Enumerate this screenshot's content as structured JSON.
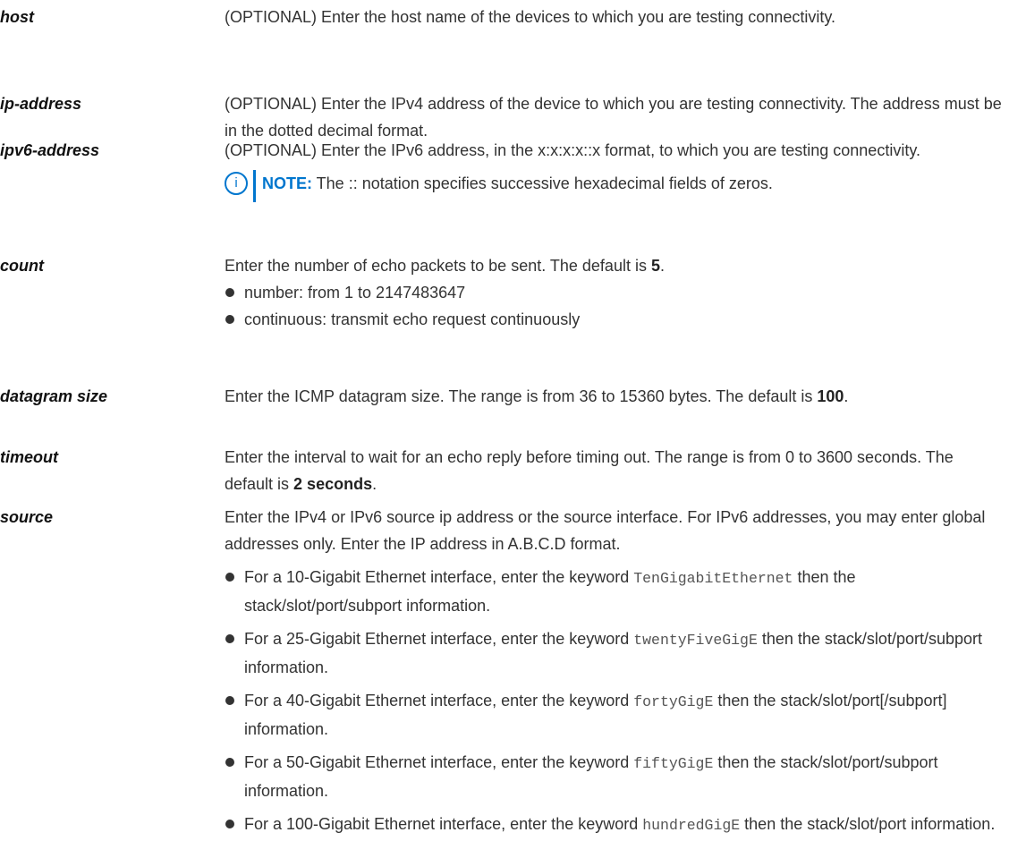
{
  "params": {
    "host": {
      "term": "host",
      "desc": "(OPTIONAL) Enter the host name of the devices to which you are testing connectivity."
    },
    "ip_address": {
      "term": "ip-address",
      "desc": "(OPTIONAL) Enter the IPv4 address of the device to which you are testing connectivity. The address must be in the dotted decimal format."
    },
    "ipv6_address": {
      "term": "ipv6-address",
      "desc": "(OPTIONAL) Enter the IPv6 address, in the x:x:x:x::x format, to which you are testing connectivity.",
      "note_icon": "info-circle",
      "note_label": "NOTE:",
      "note_text": " The :: notation specifies successive hexadecimal fields of zeros."
    },
    "count": {
      "term": "count",
      "desc_pre": "Enter the number of echo packets to be sent. The default is ",
      "desc_bold": "5",
      "desc_post": ".",
      "bullets": [
        "number: from 1 to 2147483647",
        "continuous: transmit echo request continuously"
      ]
    },
    "datagram_size": {
      "term": "datagram size",
      "desc_pre": "Enter the ICMP datagram size. The range is from 36 to 15360 bytes. The default is ",
      "desc_bold": "100",
      "desc_post": "."
    },
    "timeout": {
      "term": "timeout",
      "desc_pre": "Enter the interval to wait for an echo reply before timing out. The range is from 0 to 3600 seconds. The default is ",
      "desc_bold": "2 seconds",
      "desc_post": "."
    },
    "source": {
      "term": "source",
      "desc": "Enter the IPv4 or IPv6 source ip address or the source interface. For IPv6 addresses, you may enter global addresses only. Enter the IP address in A.B.C.D format.",
      "items": [
        {
          "pre": "For a 10-Gigabit Ethernet interface, enter the keyword ",
          "keyword": "TenGigabitEthernet",
          "post": " then the stack/slot/port/subport information."
        },
        {
          "pre": "For a 25-Gigabit Ethernet interface, enter the keyword ",
          "keyword": "twentyFiveGigE",
          "post": " then the stack/slot/port/subport information."
        },
        {
          "pre": "For a 40-Gigabit Ethernet interface, enter the keyword ",
          "keyword": "fortyGigE",
          "post": " then the stack/slot/port[/subport] information."
        },
        {
          "pre": "For a 50-Gigabit Ethernet interface, enter the keyword ",
          "keyword": "fiftyGigE",
          "post": " then the stack/slot/port/subport information."
        },
        {
          "pre": "For a 100-Gigabit Ethernet interface, enter the keyword ",
          "keyword": "hundredGigE",
          "post": " then the stack/slot/port information."
        }
      ]
    }
  },
  "colors": {
    "note_accent": "#0076ce",
    "body_text": "#333333",
    "term_text": "#111111"
  }
}
